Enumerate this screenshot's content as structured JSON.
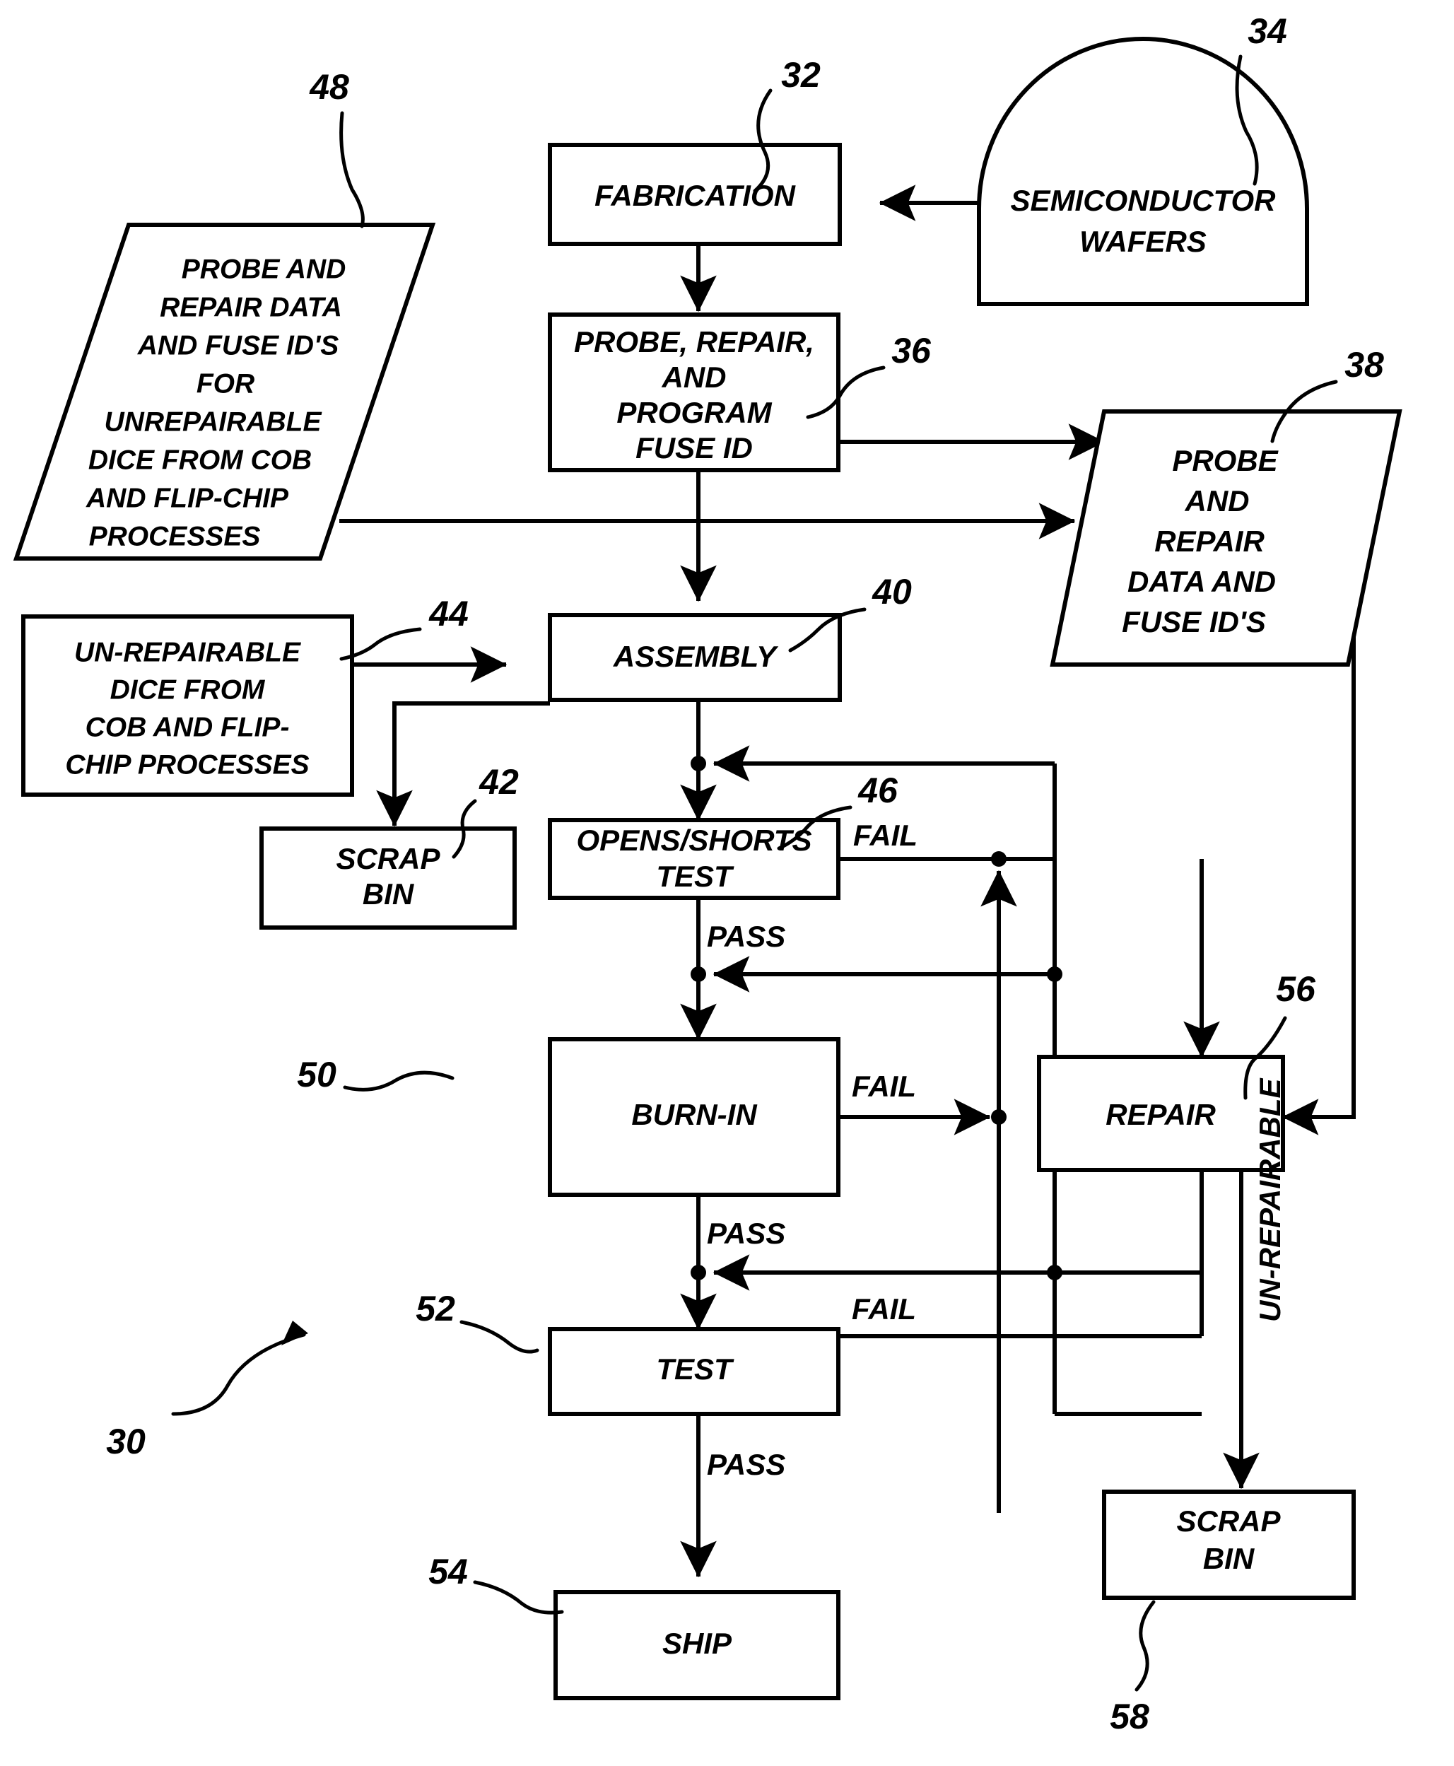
{
  "figure": {
    "type": "patent-flowchart",
    "overall_reference": "30",
    "nodes": [
      {
        "id": "fabrication",
        "ref": "32",
        "shape": "rect",
        "lines": [
          "FABRICATION"
        ]
      },
      {
        "id": "wafers",
        "ref": "34",
        "shape": "dome",
        "lines": [
          "SEMICONDUCTOR",
          "WAFERS"
        ]
      },
      {
        "id": "probe_repair",
        "ref": "36",
        "shape": "rect",
        "lines": [
          "PROBE, REPAIR,",
          "AND",
          "PROGRAM",
          "FUSE ID"
        ]
      },
      {
        "id": "data_right",
        "ref": "38",
        "shape": "parallelogram",
        "lines": [
          "PROBE",
          "AND",
          "REPAIR",
          "DATA AND",
          "FUSE ID'S"
        ]
      },
      {
        "id": "assembly",
        "ref": "40",
        "shape": "rect",
        "lines": [
          "ASSEMBLY"
        ]
      },
      {
        "id": "scrap_bin_1",
        "ref": "42",
        "shape": "rect",
        "lines": [
          "SCRAP",
          "BIN"
        ]
      },
      {
        "id": "unrep_dice",
        "ref": "44",
        "shape": "rect",
        "lines": [
          "UN-REPAIRABLE",
          "DICE FROM",
          "COB AND FLIP-",
          "CHIP PROCESSES"
        ]
      },
      {
        "id": "opens_shorts",
        "ref": "46",
        "shape": "rect",
        "lines": [
          "OPENS/SHORTS",
          "TEST"
        ]
      },
      {
        "id": "data_left",
        "ref": "48",
        "shape": "parallelogram",
        "lines": [
          "PROBE AND",
          "REPAIR DATA",
          "AND FUSE ID'S",
          "FOR",
          "UNREPAIRABLE",
          "DICE FROM COB",
          "AND FLIP-CHIP",
          "PROCESSES"
        ]
      },
      {
        "id": "burn_in",
        "ref": "50",
        "shape": "rect",
        "lines": [
          "BURN-IN"
        ]
      },
      {
        "id": "test",
        "ref": "52",
        "shape": "rect",
        "lines": [
          "TEST"
        ]
      },
      {
        "id": "ship",
        "ref": "54",
        "shape": "rect",
        "lines": [
          "SHIP"
        ]
      },
      {
        "id": "repair",
        "ref": "56",
        "shape": "rect",
        "lines": [
          "REPAIR"
        ]
      },
      {
        "id": "scrap_bin_2",
        "ref": "58",
        "shape": "rect",
        "lines": [
          "SCRAP",
          "BIN"
        ]
      }
    ],
    "edge_labels": [
      {
        "id": "os_fail",
        "text": "FAIL"
      },
      {
        "id": "os_pass",
        "text": "PASS"
      },
      {
        "id": "bi_fail",
        "text": "FAIL"
      },
      {
        "id": "bi_pass",
        "text": "PASS"
      },
      {
        "id": "test_fail",
        "text": "FAIL"
      },
      {
        "id": "test_pass",
        "text": "PASS"
      },
      {
        "id": "unrepairable_vertical",
        "text": "UN-REPAIRABLE"
      }
    ],
    "reference_numerals": [
      "30",
      "32",
      "34",
      "36",
      "38",
      "40",
      "42",
      "44",
      "46",
      "48",
      "50",
      "52",
      "54",
      "56",
      "58"
    ],
    "colors": {
      "ink": "#000000",
      "paper": "#ffffff"
    }
  }
}
